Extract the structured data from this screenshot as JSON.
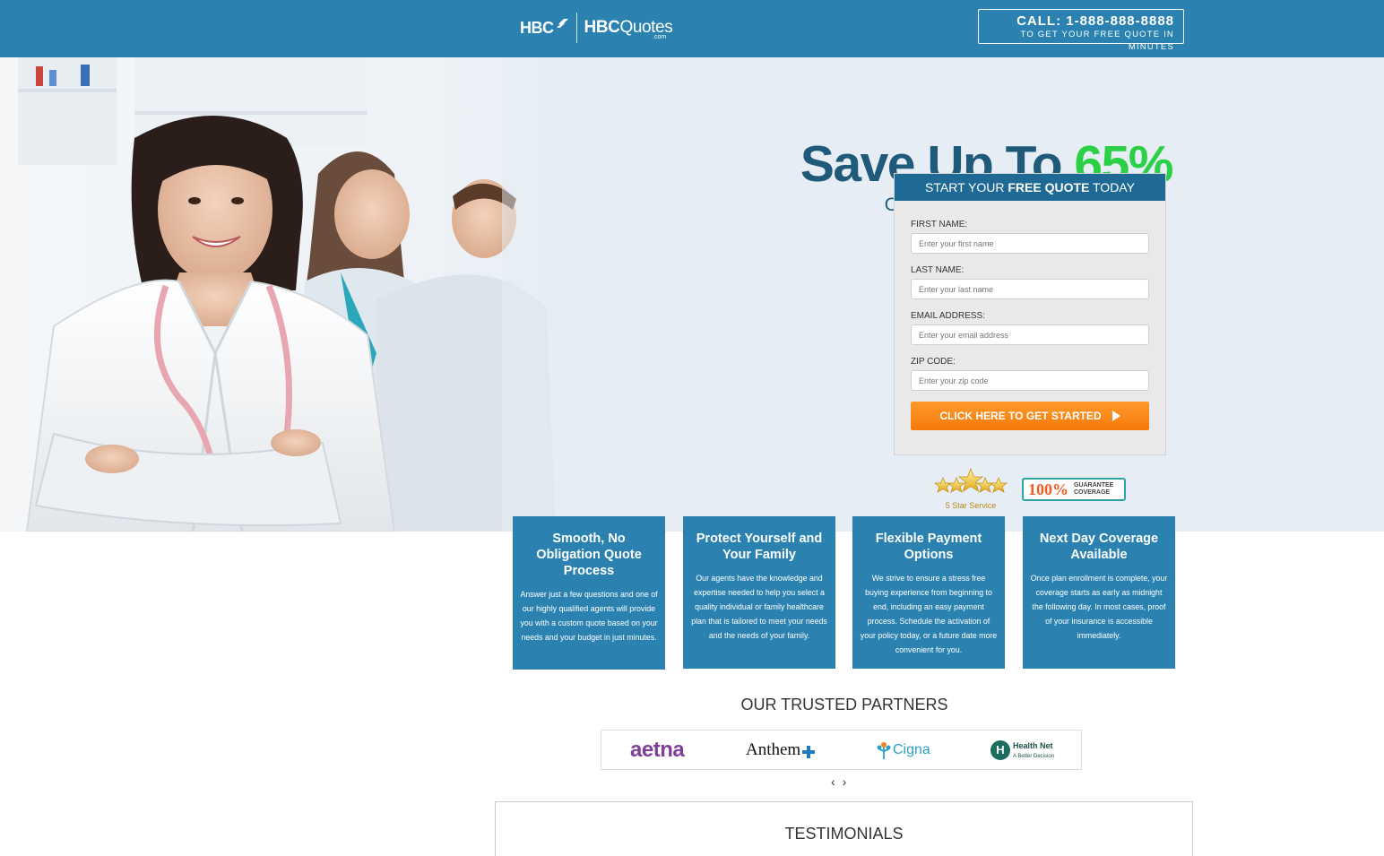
{
  "header": {
    "logo_hbc": "HBC",
    "logo_quotes_bold": "HBC",
    "logo_quotes_light": "Quotes",
    "logo_com": ".com",
    "call_line1": "CALL: 1-888-888-8888",
    "call_line2": "TO GET YOUR FREE QUOTE IN MINUTES"
  },
  "hero": {
    "headline_prefix": "Save Up To ",
    "headline_accent": "65%",
    "subheadline": "ON YOUR HEALTH INSURANCE"
  },
  "form": {
    "heading_prefix": "START YOUR ",
    "heading_bold": "FREE QUOTE",
    "heading_suffix": " TODAY",
    "fields": [
      {
        "label": "FIRST NAME:",
        "placeholder": "Enter your first name"
      },
      {
        "label": "LAST NAME:",
        "placeholder": "Enter your last name"
      },
      {
        "label": "EMAIL ADDRESS:",
        "placeholder": "Enter your email address"
      },
      {
        "label": "ZIP CODE:",
        "placeholder": "Enter your zip code"
      }
    ],
    "submit_label": "CLICK HERE TO GET STARTED"
  },
  "badges": {
    "stars_label": "5 Star Service",
    "guarantee_percent": "100%",
    "guarantee_line1": "GUARANTEE",
    "guarantee_line2": "COVERAGE"
  },
  "features": [
    {
      "title": "Smooth, No Obligation Quote Process",
      "text": "Answer just a few questions and one of our highly qualified agents will provide you with a custom quote based on your needs and your budget in just minutes."
    },
    {
      "title": "Protect Yourself and Your Family",
      "text": "Our agents have the knowledge and expertise needed to help you select a quality individual or family healthcare plan that is tailored to meet your needs and the needs of your family."
    },
    {
      "title": "Flexible Payment Options",
      "text": "We strive to ensure a stress free buying experience from beginning to end, including an easy payment process. Schedule the activation of your policy today, or a future date more convenient for you."
    },
    {
      "title": "Next Day Coverage Available",
      "text": "Once plan enrollment is complete, your coverage starts as early as midnight the following day. In most cases, proof of your insurance is accessible immediately."
    }
  ],
  "partners": {
    "title": "OUR TRUSTED PARTNERS",
    "logos": [
      "aetna",
      "Anthem",
      "Cigna",
      "Health Net"
    ],
    "healthnet_tagline": "A Better Decision",
    "prev": "‹",
    "next": "›"
  },
  "testimonials": {
    "title": "TESTIMONIALS"
  },
  "colors": {
    "brand_blue": "#2b82b1",
    "dark_blue": "#1f5a7a",
    "accent_green": "#2bd047",
    "cta_orange": "#f47a0b"
  }
}
